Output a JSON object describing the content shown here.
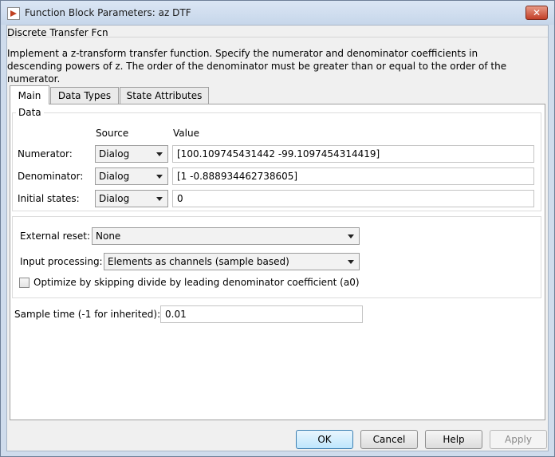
{
  "window": {
    "title": "Function Block Parameters: az DTF",
    "close_label": "✕"
  },
  "block": {
    "type_label": "Discrete Transfer Fcn",
    "description": "Implement a z-transform transfer function. Specify the numerator and denominator coefficients in descending powers of z. The order of the denominator must be greater than or equal to the order of the numerator."
  },
  "tabs": [
    {
      "label": "Main"
    },
    {
      "label": "Data Types"
    },
    {
      "label": "State Attributes"
    }
  ],
  "data_group": {
    "title": "Data",
    "col_source": "Source",
    "col_value": "Value",
    "rows": [
      {
        "label": "Numerator:",
        "source": "Dialog",
        "value": "[100.109745431442 -99.1097454314419]"
      },
      {
        "label": "Denominator:",
        "source": "Dialog",
        "value": "[1 -0.888934462738605]"
      },
      {
        "label": "Initial states:",
        "source": "Dialog",
        "value": "0"
      }
    ]
  },
  "options": {
    "external_reset_label": "External reset:",
    "external_reset_value": "None",
    "input_processing_label": "Input processing:",
    "input_processing_value": "Elements as channels (sample based)",
    "optimize_label": "Optimize by skipping divide by leading denominator coefficient (a0)",
    "optimize_checked": false
  },
  "sample_time": {
    "label": "Sample time (-1 for inherited):",
    "value": "0.01"
  },
  "buttons": {
    "ok": "OK",
    "cancel": "Cancel",
    "help": "Help",
    "apply": "Apply"
  }
}
